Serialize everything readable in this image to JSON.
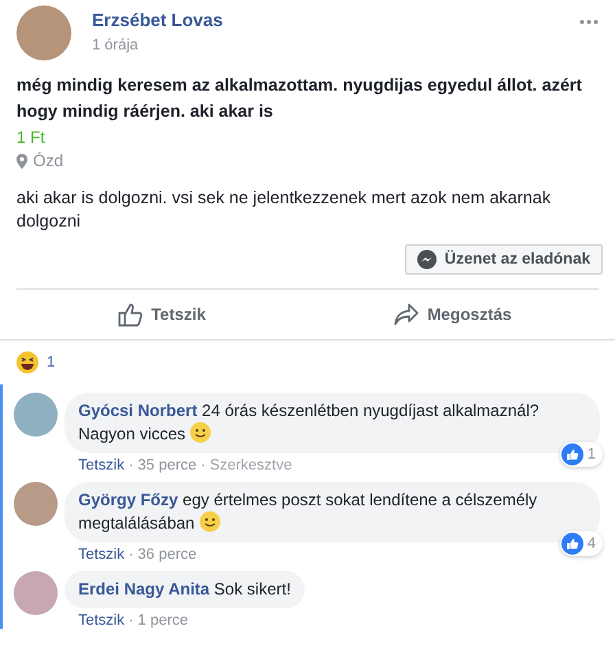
{
  "post": {
    "author": "Erzsébet Lovas",
    "time": "1 órája",
    "title": "még mindig keresem az alkalmazottam. nyugdijas egyedul állot. azért hogy mindig ráérjen. aki akar is",
    "price": "1 Ft",
    "location": "Ózd",
    "description": "aki akar is dolgozni. vsi sek ne jelentkezzenek mert azok nem akarnak dolgozni",
    "message_button": "Üzenet az eladónak"
  },
  "actions": [
    {
      "kind": "like",
      "label": "Tetszik"
    },
    {
      "kind": "share",
      "label": "Megosztás"
    }
  ],
  "reactions": {
    "count": "1"
  },
  "comments": [
    {
      "author": "Gyócsi Norbert",
      "text": "24 órás készenlétben nyugdíjast alkalmaznál? Nagyon vicces",
      "smiley": true,
      "likes": "1",
      "meta": [
        {
          "kind": "link",
          "text": "Tetszik"
        },
        {
          "kind": "sep",
          "text": "·"
        },
        {
          "kind": "time",
          "text": "35 perce"
        },
        {
          "kind": "sep",
          "text": "·"
        },
        {
          "kind": "edited",
          "text": "Szerkesztve"
        }
      ]
    },
    {
      "author": "György Főzy",
      "text": "egy értelmes poszt sokat lendítene a célszemély megtalálásában",
      "smiley": true,
      "likes": "4",
      "meta": [
        {
          "kind": "link",
          "text": "Tetszik"
        },
        {
          "kind": "sep",
          "text": "·"
        },
        {
          "kind": "time",
          "text": "36 perce"
        }
      ]
    },
    {
      "author": "Erdei Nagy Anita",
      "text": "Sok sikert!",
      "smiley": false,
      "meta": [
        {
          "kind": "link",
          "text": "Tetszik"
        },
        {
          "kind": "sep",
          "text": "·"
        },
        {
          "kind": "time",
          "text": "1 perce"
        }
      ]
    }
  ]
}
